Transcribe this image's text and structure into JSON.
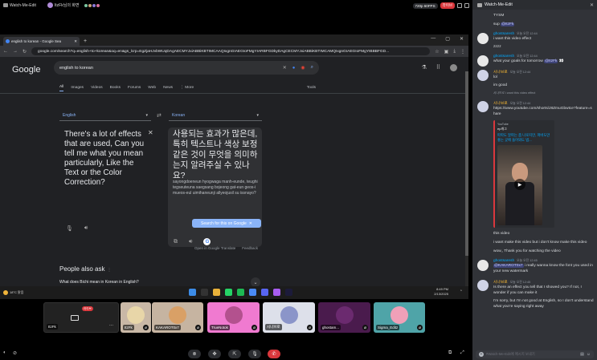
{
  "topbar": {
    "channel": "Watch-Me-Edit",
    "streamer_label": "ItzFk님의 화면",
    "stream_quality": "720p 60FPS",
    "live_label": "라이브",
    "viewer_colors": [
      "#7cc7a0",
      "#c9a37a",
      "#8e7ad8",
      "#d86f9a"
    ]
  },
  "browser": {
    "tab_title": "english to korean - Google Sea",
    "url": "google.com/search?q=english+to+korean&oq=en&gs_lcrp=EgZjaHJvbWUqDAgAECMYJxiABBiKBTIMCAAQIxgnGIAEGIoFMgYIARBFGDkyDAgCECMYJxiABBiKBTIMCAMQIxgnGIAEGIoFMgYIBBBFGD..."
  },
  "google": {
    "logo": "Google",
    "query": "english to korean",
    "nav": [
      "All",
      "Images",
      "Videos",
      "Books",
      "Forums",
      "Web",
      "News",
      "⋮ More"
    ],
    "tools": "Tools",
    "source_lang": "English",
    "target_lang": "Korean",
    "source_text": "There's a lot of effects that are used, Can you tell me what you mean particularly, Like the Text or the Color Correction?",
    "target_text": "사용되는 효과가 많은데, 특히 텍스트나 색상 보정 같은 것이 무엇을 의미하는지 알려주실 수 있나요?",
    "romanization": "sayongdoeneun hyogwaga manh-eunde, teughi tegseuteuna saegsang bojeong gat-eun geos-i mueos-eul uimihaneunji allyeojusil su issnayo?",
    "search_button": "Search for this on Google",
    "open_translate": "Open in Google Translate",
    "feedback": "Feedback",
    "paa_title": "People also ask",
    "paa_question": "What does Bichi mean in Korean in English?"
  },
  "taskbar": {
    "weather": "18°C 맑음",
    "time": "8:49 PM",
    "date": "2/13/2025"
  },
  "participants": [
    {
      "name": "ItzFk",
      "color": "#222222",
      "self": true,
      "live_label": "라이브"
    },
    {
      "name": "ItzFk",
      "color": "#c9b8a6",
      "avatar_color": "#e8d6a8"
    },
    {
      "name": "KAKAROT0x7",
      "color": "#c6b4a1",
      "avatar_color": "#d9a066"
    },
    {
      "name": "TrueNotok",
      "color": "#f07ad0",
      "avatar_color": "#b3518e"
    },
    {
      "name": "시나브로",
      "color": "#dde0ea",
      "avatar_color": "#8b95c9"
    },
    {
      "name": "ghostam...",
      "color": "#4a1b4d",
      "avatar_color": "#6b2a6f"
    },
    {
      "name": "Sigma_Editz",
      "color": "#4fa4a8",
      "avatar_color": "#f0a0b8"
    }
  ],
  "chat": {
    "header": "Watch-Me-Edit",
    "messages": [
      {
        "type": "cont",
        "text": "TYSM"
      },
      {
        "type": "cont",
        "text": "sup @ItzFk"
      },
      {
        "type": "msg",
        "user": "ghostsaresh",
        "time": "오늘 오전 12:44",
        "lines": [
          "i want this video effect",
          "zzzz"
        ],
        "avatar": "#e8e8e8"
      },
      {
        "type": "msg",
        "user": "ghostsaresh",
        "time": "오늘 오전 12:44",
        "lines": [
          "what your goals for tomorrow @ItzFk 👀"
        ],
        "avatar": "#e8e8e8"
      },
      {
        "type": "msg",
        "user": "시나브로",
        "time": "오늘 오전 12:44",
        "lines": [
          "lol",
          "im good"
        ],
        "avatar": "#cfd3e6",
        "orange": true
      },
      {
        "type": "reply",
        "text": "시나브로 i want this video effect"
      },
      {
        "type": "msg",
        "user": "시나브로",
        "time": "오늘 오전 12:44",
        "lines": [
          "https://www.youtube.com/shorts/J8ZmuGbwtce?feature=share"
        ],
        "avatar": "#cfd3e6",
        "orange": true,
        "link": true
      },
      {
        "type": "embed",
        "provider": "YouTube",
        "author": "ep개그",
        "title": "파파도 알파는 좀 나로지만, 파바도만 좋는 곳에 들어와도 법..."
      },
      {
        "type": "cont",
        "text": "this video"
      },
      {
        "type": "cont",
        "text": "i want make this video but i don't know make this video"
      },
      {
        "type": "cont",
        "text": "wow,, Thank you for watching the video"
      },
      {
        "type": "msg",
        "user": "ghostsaresh",
        "time": "오늘 오전 12:45",
        "lines": [
          "@KAKAROT0x7 i really wanna know the font you used in your new watermark"
        ],
        "avatar": "#e8e8e8"
      },
      {
        "type": "msg",
        "user": "시나브로",
        "time": "오늘 오전 12:45",
        "lines": [
          "Is there an effect you tell that I showed you? If not, I wonder if you can make it",
          "I'm sorry, but I'm not good at English, so I don't understand what you're saying right away"
        ],
        "avatar": "#cfd3e6",
        "orange": true
      }
    ],
    "input_placeholder": "#Watch-Me-Edit에 메시지 보내기"
  }
}
